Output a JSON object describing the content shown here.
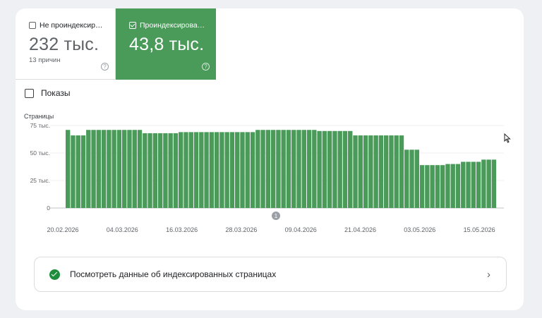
{
  "tabs": [
    {
      "label": "Не проиндексир…",
      "value": "232 тыс.",
      "sub": "13 причин",
      "checked": false
    },
    {
      "label": "Проиндексирова…",
      "value": "43,8 тыс.",
      "sub": "",
      "checked": true
    }
  ],
  "impressions_label": "Показы",
  "chart_data": {
    "type": "bar",
    "ylabel": "Страницы",
    "ylim": [
      0,
      75000
    ],
    "y_ticks": [
      "0",
      "25 тыс.",
      "50 тыс.",
      "75 тыс."
    ],
    "x_tick_labels": [
      "20.02.2026",
      "04.03.2026",
      "16.03.2026",
      "28.03.2026",
      "09.04.2026",
      "21.04.2026",
      "03.05.2026",
      "15.05.2026"
    ],
    "annotation": "1",
    "color": "#4a9b5a",
    "values": [
      71000,
      66000,
      66000,
      66000,
      71000,
      71000,
      71000,
      71000,
      71000,
      71000,
      71000,
      71000,
      71000,
      71000,
      71000,
      68000,
      68000,
      68000,
      68000,
      68000,
      68000,
      68000,
      69000,
      69000,
      69000,
      69000,
      69000,
      69000,
      69000,
      69000,
      69000,
      69000,
      69000,
      69000,
      69000,
      69000,
      69000,
      71000,
      71000,
      71000,
      71000,
      71000,
      71000,
      71000,
      71000,
      71000,
      71000,
      71000,
      71000,
      70000,
      70000,
      70000,
      70000,
      70000,
      70000,
      70000,
      66000,
      66000,
      66000,
      66000,
      66000,
      66000,
      66000,
      66000,
      66000,
      66000,
      53000,
      53000,
      53000,
      39000,
      39000,
      39000,
      39000,
      39000,
      40000,
      40000,
      40000,
      42000,
      42000,
      42000,
      42000,
      44000,
      44000,
      44000
    ]
  },
  "link": {
    "label": "Посмотреть данные об индексированных страницах"
  }
}
